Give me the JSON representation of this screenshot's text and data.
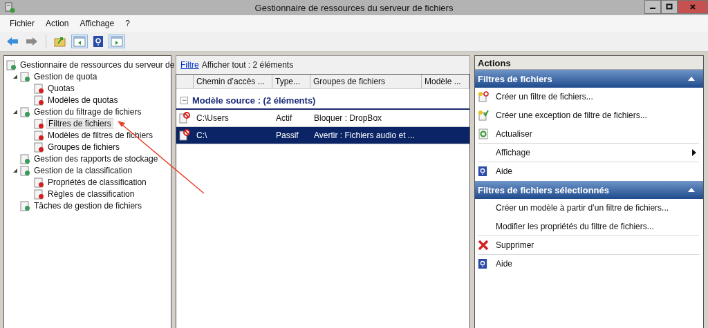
{
  "window": {
    "title": "Gestionnaire de ressources du serveur de fichiers"
  },
  "menu": [
    "Fichier",
    "Action",
    "Affichage",
    "?"
  ],
  "tree": [
    {
      "label": "Gestionnaire de ressources du serveur de",
      "selected": false,
      "children": [
        {
          "label": "Gestion de quota",
          "selected": false,
          "expanded": true,
          "children": [
            {
              "label": "Quotas",
              "selected": false
            },
            {
              "label": "Modèles de quotas",
              "selected": false
            }
          ]
        },
        {
          "label": "Gestion du filtrage de fichiers",
          "selected": false,
          "expanded": true,
          "children": [
            {
              "label": "Filtres de fichiers",
              "selected": true
            },
            {
              "label": "Modèles de filtres de fichiers",
              "selected": false
            },
            {
              "label": "Groupes de fichiers",
              "selected": false
            }
          ]
        },
        {
          "label": "Gestion des rapports de stockage",
          "selected": false
        },
        {
          "label": "Gestion de la classification",
          "selected": false,
          "expanded": true,
          "children": [
            {
              "label": "Propriétés de classification",
              "selected": false
            },
            {
              "label": "Règles de classification",
              "selected": false
            }
          ]
        },
        {
          "label": "Tâches de gestion de fichiers",
          "selected": false
        }
      ]
    }
  ],
  "filter_bar": {
    "link": "Filtre",
    "text": "Afficher tout : 2 éléments"
  },
  "table": {
    "columns": [
      "Chemin d’accès ...",
      "Type...",
      "Groupes de fichiers",
      "Modèle ..."
    ],
    "group": {
      "toggle": "−",
      "label": "Modèle source : (2 éléments)"
    },
    "rows": [
      {
        "cells": [
          "C:\\Users",
          "Actif",
          "Bloquer : DropBox",
          ""
        ],
        "selected": false
      },
      {
        "cells": [
          "C:\\",
          "Passif",
          "Avertir : Fichiers audio et ...",
          ""
        ],
        "selected": true
      }
    ]
  },
  "actions": {
    "title": "Actions",
    "sections": [
      {
        "title": "Filtres de fichiers",
        "items": [
          {
            "label": "Créer un filtre de fichiers...",
            "kind": "new-filter",
            "separator": false
          },
          {
            "label": "Créer une exception de filtre de fichiers...",
            "kind": "new-exception",
            "separator": false
          },
          {
            "label": "Actualiser",
            "kind": "refresh",
            "separator": true
          },
          {
            "label": "Affichage",
            "kind": "submenu",
            "separator": true
          },
          {
            "label": "Aide",
            "kind": "help",
            "separator": false
          }
        ]
      },
      {
        "title": "Filtres de fichiers sélectionnés",
        "items": [
          {
            "label": "Créer un modèle à partir d’un filtre de fichiers...",
            "kind": "plain",
            "separator": false
          },
          {
            "label": "Modifier les propriétés du filtre de fichiers...",
            "kind": "plain",
            "separator": true
          },
          {
            "label": "Supprimer",
            "kind": "delete",
            "separator": true
          },
          {
            "label": "Aide",
            "kind": "help",
            "separator": false
          }
        ]
      }
    ]
  }
}
